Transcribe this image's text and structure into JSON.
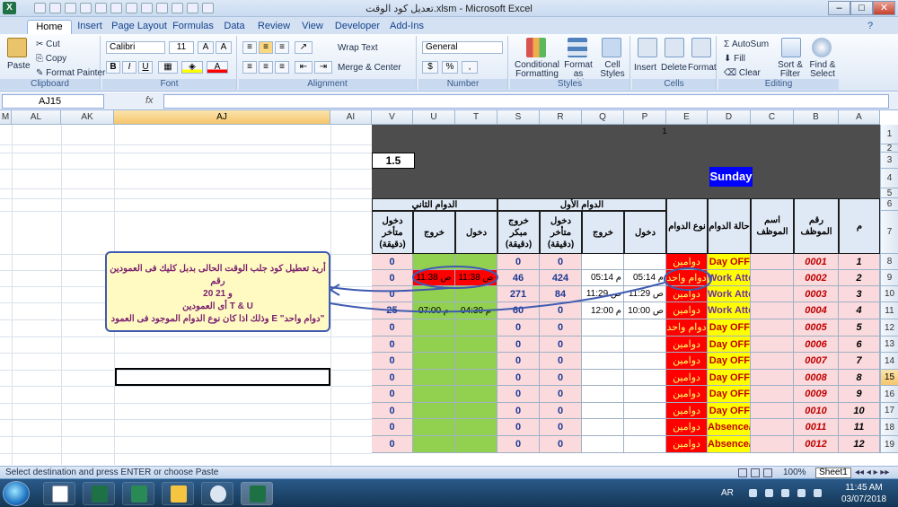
{
  "window": {
    "title": "تعديل كود الوقت.xlsm - Microsoft Excel",
    "app_icon": "X",
    "controls": [
      "–",
      "□",
      "✕"
    ]
  },
  "ribbon": {
    "tabs": [
      "Home",
      "Insert",
      "Page Layout",
      "Formulas",
      "Data",
      "Review",
      "View",
      "Developer",
      "Add-Ins"
    ],
    "active_tab": "Home",
    "clipboard": {
      "paste": "Paste",
      "cut": "Cut",
      "copy": "Copy",
      "format_painter": "Format Painter",
      "label": "Clipboard"
    },
    "font": {
      "name": "Calibri",
      "size": "11",
      "label": "Font",
      "bold": "B",
      "italic": "I",
      "underline": "U"
    },
    "alignment": {
      "wrap_text": "Wrap Text",
      "merge_center": "Merge & Center",
      "label": "Alignment"
    },
    "number": {
      "format": "General",
      "currency": "$",
      "percent": "%",
      "comma": ",",
      "label": "Number"
    },
    "styles": {
      "conditional": "Conditional Formatting",
      "format_table": "Format as Table",
      "cell_styles": "Cell Styles",
      "label": "Styles"
    },
    "cells": {
      "insert": "Insert",
      "delete": "Delete",
      "format": "Format",
      "label": "Cells"
    },
    "editing": {
      "autosum": "AutoSum",
      "fill": "Fill",
      "clear": "Clear",
      "sort_filter": "Sort & Filter",
      "find_select": "Find & Select",
      "label": "Editing"
    }
  },
  "formula_bar": {
    "name_box": "AJ15",
    "fx": "fx",
    "formula": ""
  },
  "columns": [
    "M",
    "AL",
    "AK",
    "AJ",
    "AI",
    "V",
    "U",
    "T",
    "S",
    "R",
    "Q",
    "P",
    "E",
    "D",
    "C",
    "B",
    "A"
  ],
  "selected_column": "AJ",
  "rows": [
    "1",
    "2",
    "3",
    "4",
    "5",
    "6",
    "7",
    "8",
    "9",
    "10",
    "11",
    "12",
    "13",
    "14",
    "15",
    "16",
    "17",
    "18",
    "19"
  ],
  "selected_row": "15",
  "sheet": {
    "page_number": "1",
    "factor": "1.5",
    "day": "Sunday",
    "second_shift_header": "الدوام الثاني",
    "first_shift_header": "الدوام الأول",
    "headers": {
      "late_in_2": "دخول متأخر (دقيقة)",
      "out_2": "خروج",
      "in_2": "دخول",
      "early_out": "خروج مبكر (دقيقة)",
      "late_in_1": "دخول متأخر (دقيقة)",
      "out_1": "خروج",
      "in_1": "دخول",
      "shift_type": "نوع الدوام",
      "shift_status": "حالة الدوام",
      "employee_name": "اسم الموظف",
      "employee_no": "رقم الموظف",
      "index": "م"
    },
    "rows": [
      {
        "m": "1",
        "no": "0001",
        "status": "Day OFF",
        "type": "دوامين",
        "p": "",
        "q": "",
        "r": "0",
        "s": "0",
        "t": "",
        "u": "",
        "v": "0"
      },
      {
        "m": "2",
        "no": "0002",
        "status": "Work Attended",
        "type": "دوام واحد",
        "p": "05:14 م",
        "q": "05:14 م",
        "r": "424",
        "s": "46",
        "t": "11:38 ص",
        "u": "11:38 ص",
        "v": "0"
      },
      {
        "m": "3",
        "no": "0003",
        "status": "Work Attended",
        "type": "دوامين",
        "p": "11:29 ص",
        "q": "11:29 ص",
        "r": "84",
        "s": "271",
        "t": "",
        "u": "",
        "v": "0"
      },
      {
        "m": "4",
        "no": "0004",
        "status": "Work Attended",
        "type": "دوامين",
        "p": "10:00 ص",
        "q": "12:00 م",
        "r": "0",
        "s": "60",
        "t": "04:30 م",
        "u": "07:00 م",
        "v": "25"
      },
      {
        "m": "5",
        "no": "0005",
        "status": "Day OFF",
        "type": "دوام واحد",
        "p": "",
        "q": "",
        "r": "0",
        "s": "0",
        "t": "",
        "u": "",
        "v": "0"
      },
      {
        "m": "6",
        "no": "0006",
        "status": "Day OFF",
        "type": "دوامين",
        "p": "",
        "q": "",
        "r": "0",
        "s": "0",
        "t": "",
        "u": "",
        "v": "0"
      },
      {
        "m": "7",
        "no": "0007",
        "status": "Day OFF",
        "type": "دوامين",
        "p": "",
        "q": "",
        "r": "0",
        "s": "0",
        "t": "",
        "u": "",
        "v": "0"
      },
      {
        "m": "8",
        "no": "0008",
        "status": "Day OFF",
        "type": "دوامين",
        "p": "",
        "q": "",
        "r": "0",
        "s": "0",
        "t": "",
        "u": "",
        "v": "0"
      },
      {
        "m": "9",
        "no": "0009",
        "status": "Day OFF",
        "type": "دوامين",
        "p": "",
        "q": "",
        "r": "0",
        "s": "0",
        "t": "",
        "u": "",
        "v": "0"
      },
      {
        "m": "10",
        "no": "0010",
        "status": "Day OFF",
        "type": "دوامين",
        "p": "",
        "q": "",
        "r": "0",
        "s": "0",
        "t": "",
        "u": "",
        "v": "0"
      },
      {
        "m": "11",
        "no": "0011",
        "status": "Absence/Vacation",
        "type": "دوامين",
        "p": "",
        "q": "",
        "r": "0",
        "s": "0",
        "t": "",
        "u": "",
        "v": "0"
      },
      {
        "m": "12",
        "no": "0012",
        "status": "Absence/Vacation",
        "type": "دوامين",
        "p": "",
        "q": "",
        "r": "0",
        "s": "0",
        "t": "",
        "u": "",
        "v": "0"
      }
    ],
    "note_lines": [
      "أريد تعطيل كود جلب الوقت الحالى بدبل كليك فى العمودين رقم",
      "20 و 21",
      "أى العمودين T & U",
      "وذلك اذا كان نوع الدوام الموجود فى العمود E \"دوام واحد\""
    ]
  },
  "status_bar": {
    "text": "Select destination and press ENTER or choose Paste",
    "zoom": "100%",
    "sheet_tab": "Sheet1"
  },
  "taskbar": {
    "language": "AR",
    "time": "11:45 AM",
    "date": "03/07/2018"
  },
  "colors": {
    "status_yellow": "#ffff00",
    "shift_red": "#ff0000",
    "green_col": "#92d050",
    "pink": "#fadadd",
    "day_blue": "#0000ff"
  }
}
